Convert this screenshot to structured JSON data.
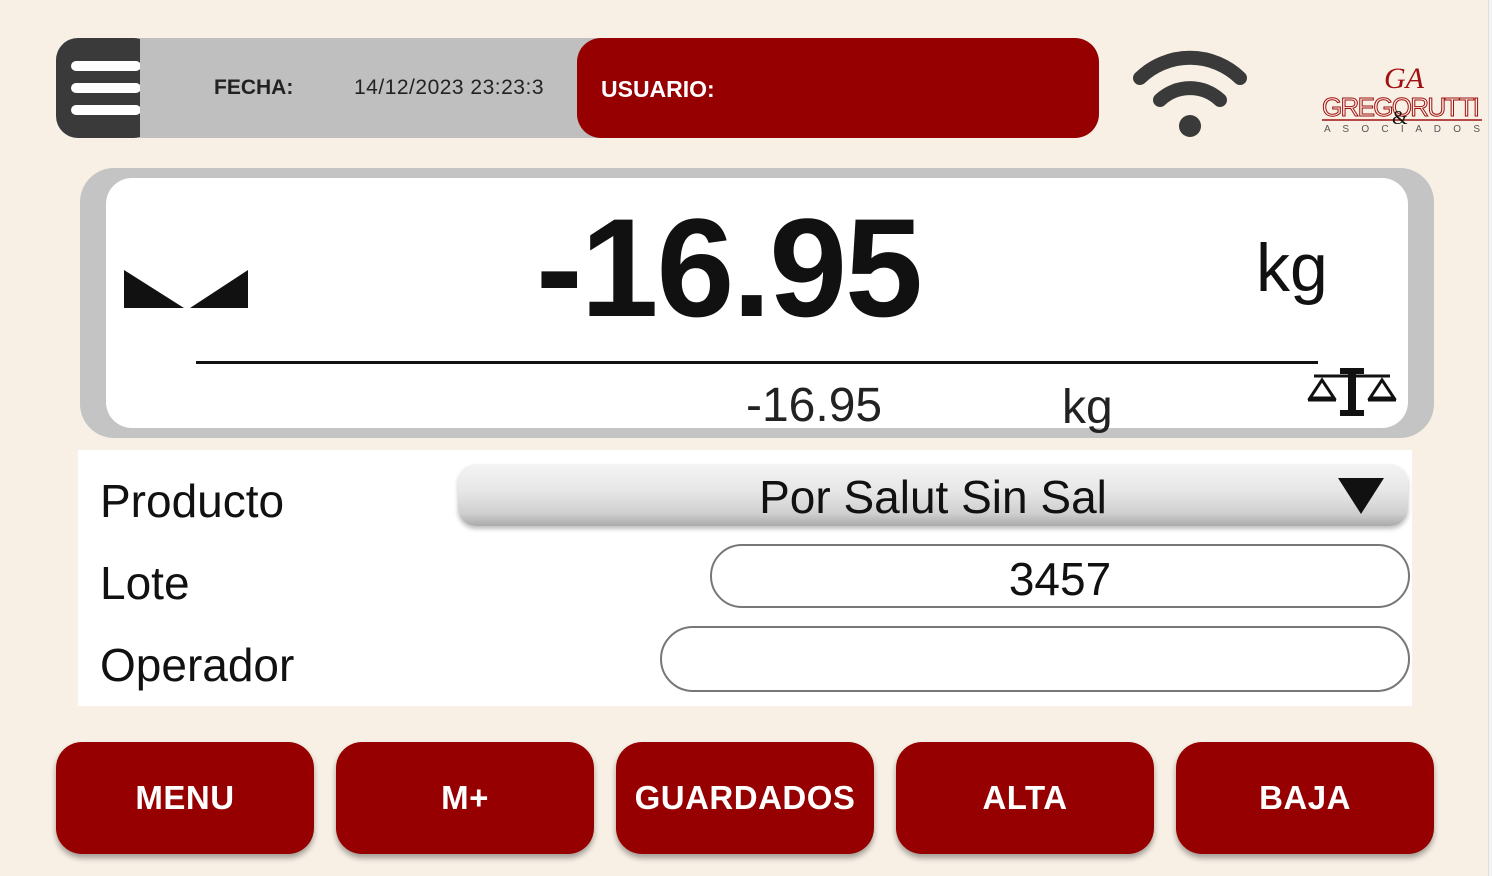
{
  "header": {
    "fecha_label": "FECHA:",
    "fecha_value": "14/12/2023 23:23:3",
    "usuario_label": "USUARIO:",
    "logo_initials": "GA",
    "logo_name": "GREGORUTTI",
    "logo_sub": "A S O C I A D O S"
  },
  "weight": {
    "main_value": "-16.95",
    "main_unit": "kg",
    "secondary_value": "-16.95",
    "secondary_unit": "kg"
  },
  "form": {
    "producto_label": "Producto",
    "producto_value": "Por Salut Sin Sal",
    "lote_label": "Lote",
    "lote_value": "3457",
    "operador_label": "Operador",
    "operador_value": ""
  },
  "buttons": {
    "menu": "MENU",
    "mplus": "M+",
    "guardados": "GUARDADOS",
    "alta": "ALTA",
    "baja": "BAJA"
  },
  "icons": {
    "menu": "hamburger-icon",
    "wifi": "wifi-icon",
    "stable": "stability-indicator-icon",
    "scale": "balance-scale-icon",
    "dropdown": "dropdown-arrow-icon"
  },
  "colors": {
    "accent_red": "#960000",
    "background": "#f8f0e5",
    "info_bar_gray": "#bfbfbf",
    "menu_button_dark": "#3a3a3a"
  }
}
